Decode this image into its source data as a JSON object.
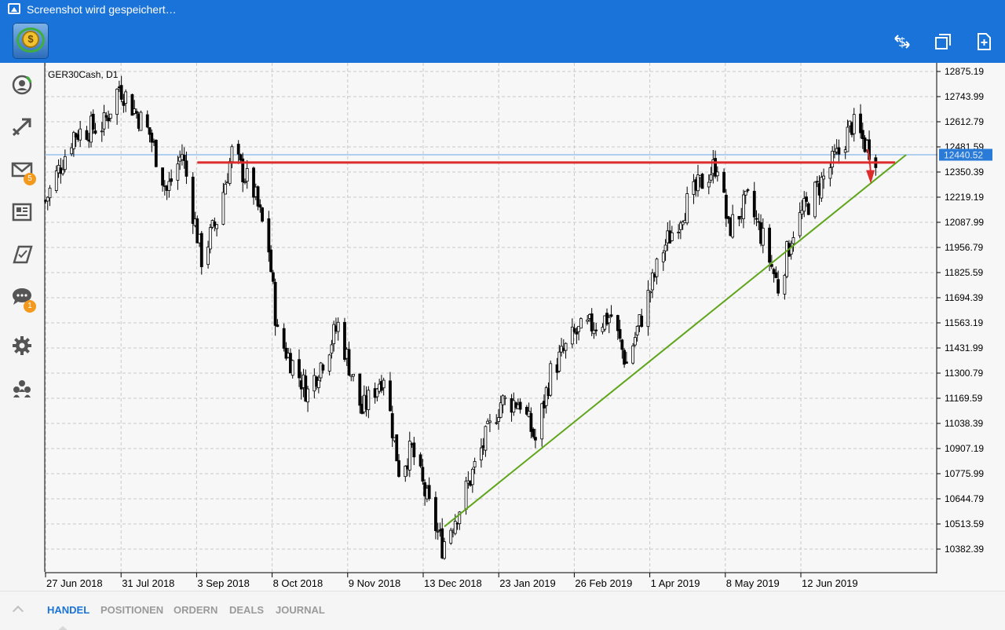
{
  "status": {
    "text": "Screenshot wird gespeichert…"
  },
  "sidebar": {
    "items": [
      {
        "name": "quotes-icon",
        "badge": ""
      },
      {
        "name": "trade-icon",
        "badge": ""
      },
      {
        "name": "mail-icon",
        "badge": "5"
      },
      {
        "name": "news-icon",
        "badge": ""
      },
      {
        "name": "tradays-icon",
        "badge": ""
      },
      {
        "name": "chat-icon",
        "badge": "1"
      },
      {
        "name": "settings-icon",
        "badge": ""
      },
      {
        "name": "community-icon",
        "badge": ""
      }
    ]
  },
  "tabs": {
    "items": [
      "HANDEL",
      "POSITIONEN",
      "ORDERN",
      "DEALS",
      "JOURNAL"
    ],
    "active": "HANDEL"
  },
  "chart_data": {
    "type": "candlestick",
    "symbol_label": "GER30Cash, D1",
    "price_labels": [
      "12875.19",
      "12743.99",
      "12612.79",
      "12481.59",
      "12350.39",
      "12219.19",
      "12087.99",
      "11956.79",
      "11825.59",
      "11694.39",
      "11563.19",
      "11431.99",
      "11300.79",
      "11169.59",
      "11038.39",
      "10907.19",
      "10775.99",
      "10644.79",
      "10513.59",
      "10382.39"
    ],
    "date_labels": [
      "27 Jun 2018",
      "31 Jul 2018",
      "3 Sep 2018",
      "8 Oct 2018",
      "9 Nov 2018",
      "13 Dec 2018",
      "23 Jan 2019",
      "26 Feb 2019",
      "1 Apr 2019",
      "8 May 2019",
      "12 Jun 2019"
    ],
    "current_price": "12440.52",
    "grid": true,
    "closes_approx": [
      [
        "2018-06-27",
        12200
      ],
      [
        "2018-07-10",
        12550
      ],
      [
        "2018-07-24",
        12600
      ],
      [
        "2018-07-31",
        12800
      ],
      [
        "2018-08-14",
        12550
      ],
      [
        "2018-08-22",
        12250
      ],
      [
        "2018-08-29",
        12450
      ],
      [
        "2018-09-07",
        11900
      ],
      [
        "2018-09-14",
        12100
      ],
      [
        "2018-09-21",
        12450
      ],
      [
        "2018-10-01",
        12250
      ],
      [
        "2018-10-08",
        11950
      ],
      [
        "2018-10-12",
        11500
      ],
      [
        "2018-10-26",
        11200
      ],
      [
        "2018-11-09",
        11550
      ],
      [
        "2018-11-20",
        11100
      ],
      [
        "2018-11-30",
        11300
      ],
      [
        "2018-12-07",
        10800
      ],
      [
        "2018-12-13",
        10900
      ],
      [
        "2018-12-21",
        10600
      ],
      [
        "2018-12-27",
        10400
      ],
      [
        "2019-01-04",
        10600
      ],
      [
        "2019-01-14",
        10900
      ],
      [
        "2019-01-23",
        11150
      ],
      [
        "2019-02-01",
        11150
      ],
      [
        "2019-02-08",
        10950
      ],
      [
        "2019-02-15",
        11300
      ],
      [
        "2019-02-26",
        11500
      ],
      [
        "2019-03-06",
        11550
      ],
      [
        "2019-03-15",
        11600
      ],
      [
        "2019-03-22",
        11350
      ],
      [
        "2019-04-01",
        11700
      ],
      [
        "2019-04-08",
        11950
      ],
      [
        "2019-04-17",
        12150
      ],
      [
        "2019-04-26",
        12300
      ],
      [
        "2019-05-03",
        12400
      ],
      [
        "2019-05-08",
        12050
      ],
      [
        "2019-05-17",
        12200
      ],
      [
        "2019-05-24",
        12000
      ],
      [
        "2019-05-31",
        11750
      ],
      [
        "2019-06-07",
        12050
      ],
      [
        "2019-06-12",
        12150
      ],
      [
        "2019-06-20",
        12300
      ],
      [
        "2019-06-28",
        12450
      ],
      [
        "2019-07-04",
        12600
      ],
      [
        "2019-07-10",
        12500
      ],
      [
        "2019-07-15",
        12440
      ]
    ],
    "drawings": {
      "horizontal_line": {
        "price": 12400,
        "from": "2018-09-05",
        "to": "2019-07-24",
        "color": "#dd2c2c"
      },
      "trendline": {
        "from": [
          "2018-12-28",
          10500
        ],
        "to": [
          "2019-07-29",
          12440
        ],
        "color": "#5ea51a"
      },
      "arrow": {
        "color": "#dd2c2c"
      }
    }
  },
  "colors": {
    "accent": "#1a73d9",
    "badge": "#f39a1e",
    "bull": "#ffffff",
    "bear": "#000000"
  }
}
